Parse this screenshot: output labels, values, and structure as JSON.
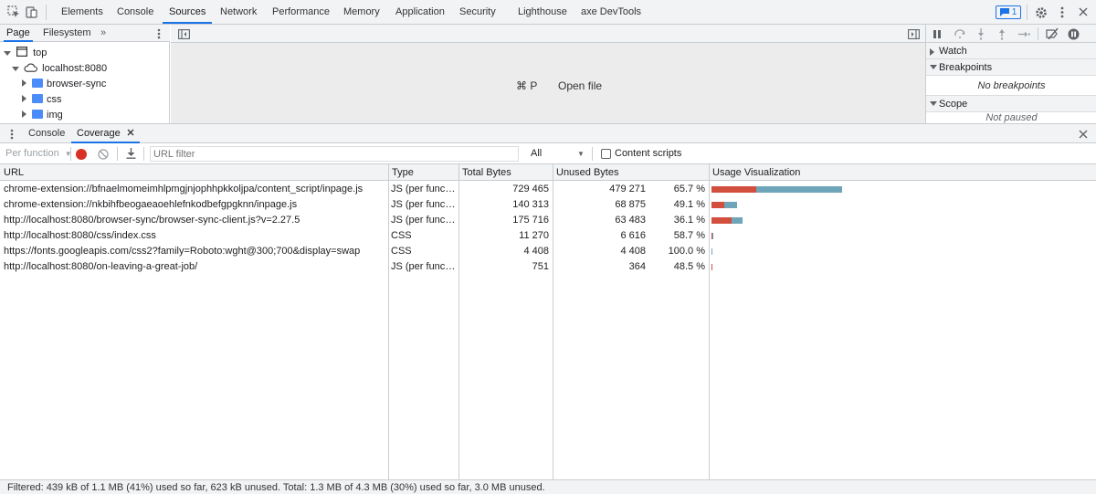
{
  "topbar": {
    "tabs": [
      "Elements",
      "Console",
      "Sources",
      "Network",
      "Performance",
      "Memory",
      "Application",
      "Security",
      "Lighthouse",
      "axe DevTools"
    ],
    "active_tab": "Sources",
    "issues_count": "1"
  },
  "navigator": {
    "tabs": [
      "Page",
      "Filesystem"
    ],
    "more": "»",
    "tree": {
      "top": "top",
      "host": "localhost:8080",
      "folders": [
        "browser-sync",
        "css",
        "img"
      ]
    }
  },
  "editor": {
    "shortcut": "⌘ P",
    "open_file": "Open file"
  },
  "debugger": {
    "watch": "Watch",
    "breakpoints": "Breakpoints",
    "no_breakpoints": "No breakpoints",
    "scope": "Scope",
    "not_paused": "Not paused"
  },
  "drawer": {
    "tabs": [
      "Console",
      "Coverage"
    ],
    "active_tab": "Coverage"
  },
  "coverage_toolbar": {
    "mode": "Per function",
    "url_filter_placeholder": "URL filter",
    "type_select": "All",
    "content_scripts_label": "Content scripts"
  },
  "coverage_table": {
    "headers": [
      "URL",
      "Type",
      "Total Bytes",
      "Unused Bytes",
      "Usage Visualization"
    ],
    "rows": [
      {
        "url": "chrome-extension://bfnaelmomeimhlpmgjnjophhpkkoljpa/content_script/inpage.js",
        "type": "JS (per function)",
        "total": "729 465",
        "unused": "479 271",
        "pct": "65.7 %",
        "total_val": 729465,
        "unused_val": 479271
      },
      {
        "url": "chrome-extension://nkbihfbeogaeaoehlefnkodbefgpgknn/inpage.js",
        "type": "JS (per function)",
        "total": "140 313",
        "unused": "68 875",
        "pct": "49.1 %",
        "total_val": 140313,
        "unused_val": 68875
      },
      {
        "url": "http://localhost:8080/browser-sync/browser-sync-client.js?v=2.27.5",
        "type": "JS (per function)",
        "total": "175 716",
        "unused": "63 483",
        "pct": "36.1 %",
        "total_val": 175716,
        "unused_val": 63483
      },
      {
        "url": "http://localhost:8080/css/index.css",
        "type": "CSS",
        "total": "11 270",
        "unused": "6 616",
        "pct": "58.7 %",
        "total_val": 11270,
        "unused_val": 6616
      },
      {
        "url": "https://fonts.googleapis.com/css2?family=Roboto:wght@300;700&display=swap",
        "type": "CSS",
        "total": "4 408",
        "unused": "4 408",
        "pct": "100.0 %",
        "total_val": 4408,
        "unused_val": 4408
      },
      {
        "url": "http://localhost:8080/on-leaving-a-great-job/",
        "type": "JS (per function)",
        "total": "751",
        "unused": "364",
        "pct": "48.5 %",
        "total_val": 751,
        "unused_val": 364
      }
    ]
  },
  "status": "Filtered: 439 kB of 1.1 MB (41%) used so far, 623 kB unused. Total: 1.3 MB of 4.3 MB (30%) used so far, 3.0 MB unused.",
  "colors": {
    "accent": "#1a73e8",
    "used_bar": "#d24f3e",
    "unused_bar": "#6fa5b8",
    "record": "#d93025"
  }
}
